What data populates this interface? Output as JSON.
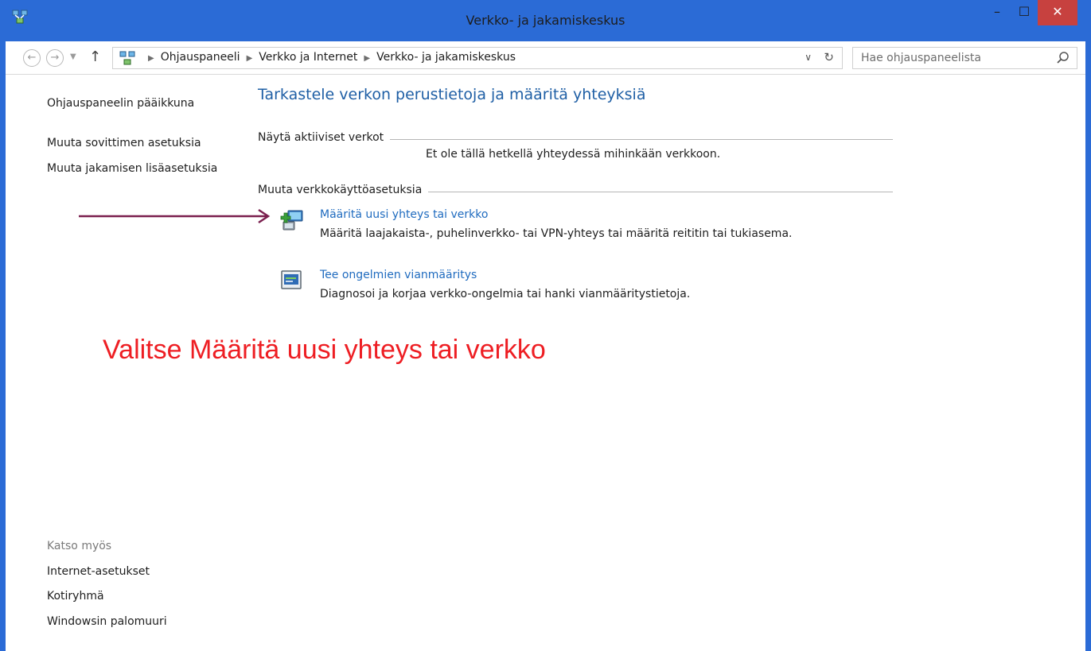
{
  "window": {
    "title": "Verkko- ja jakamiskeskus",
    "minimize": "–",
    "maximize": "☐",
    "close": "✕",
    "accent_color": "#2b6bd6",
    "close_color": "#c7413f"
  },
  "address_bar": {
    "back": "←",
    "forward": "→",
    "up": "↑",
    "breadcrumbs": [
      "Ohjauspaneeli",
      "Verkko ja Internet",
      "Verkko- ja jakamiskeskus"
    ],
    "search_placeholder": "Hae ohjauspaneelista"
  },
  "left_pane": {
    "links": [
      "Ohjauspaneelin pääikkuna",
      "Muuta sovittimen asetuksia",
      "Muuta jakamisen lisäasetuksia"
    ],
    "see_also_heading": "Katso myös",
    "see_also": [
      "Internet-asetukset",
      "Kotiryhmä",
      "Windowsin palomuuri"
    ]
  },
  "main": {
    "title": "Tarkastele verkon perustietoja ja määritä yhteyksiä",
    "active_networks_label": "Näytä aktiiviset verkot",
    "active_networks_notice": "Et ole tällä hetkellä yhteydessä mihinkään verkkoon.",
    "change_settings_label": "Muuta verkkokäyttöasetuksia",
    "tasks": [
      {
        "link": "Määritä uusi yhteys tai verkko",
        "description": "Määritä laajakaista-, puhelinverkko- tai VPN-yhteys tai määritä reititin tai tukiasema.",
        "icon": "new-connection-icon"
      },
      {
        "link": "Tee ongelmien vianmääritys",
        "description": "Diagnosoi ja korjaa verkko-ongelmia tai hanki vianmääritystietoja.",
        "icon": "troubleshoot-icon"
      }
    ]
  },
  "annotation": {
    "text": "Valitse Määritä uusi yhteys tai verkko",
    "color": "#ee1e23",
    "arrow_color": "#7a1f4e"
  }
}
